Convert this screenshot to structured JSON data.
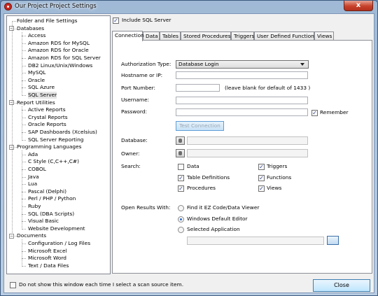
{
  "window": {
    "title": "Our Project Project Settings",
    "close_glyph": "x"
  },
  "tree": {
    "items": [
      {
        "label": "Folder and File Settings",
        "level": 0,
        "toggle": ""
      },
      {
        "label": "Databases",
        "level": 0,
        "toggle": "−"
      },
      {
        "label": "Access",
        "level": 1
      },
      {
        "label": "Amazon RDS for MySQL",
        "level": 1
      },
      {
        "label": "Amazon RDS for Oracle",
        "level": 1
      },
      {
        "label": "Amazon RDS for SQL Server",
        "level": 1
      },
      {
        "label": "DB2 Linux/Unix/Windows",
        "level": 1
      },
      {
        "label": "MySQL",
        "level": 1
      },
      {
        "label": "Oracle",
        "level": 1
      },
      {
        "label": "SQL Azure",
        "level": 1
      },
      {
        "label": "SQL Server",
        "level": 1,
        "selected": true
      },
      {
        "label": "Report Utilities",
        "level": 0,
        "toggle": "−"
      },
      {
        "label": "Active Reports",
        "level": 1
      },
      {
        "label": "Crystal Reports",
        "level": 1
      },
      {
        "label": "Oracle Reports",
        "level": 1
      },
      {
        "label": "SAP Dashboards (Xcelsius)",
        "level": 1
      },
      {
        "label": "SQL Server Reporting",
        "level": 1
      },
      {
        "label": "Programming Languages",
        "level": 0,
        "toggle": "−"
      },
      {
        "label": "Ada",
        "level": 1
      },
      {
        "label": "C Style (C,C++,C#)",
        "level": 1
      },
      {
        "label": "COBOL",
        "level": 1
      },
      {
        "label": "Java",
        "level": 1
      },
      {
        "label": "Lua",
        "level": 1
      },
      {
        "label": "Pascal (Delphi)",
        "level": 1
      },
      {
        "label": "Perl / PHP / Python",
        "level": 1
      },
      {
        "label": "Ruby",
        "level": 1
      },
      {
        "label": "SQL (DBA Scripts)",
        "level": 1
      },
      {
        "label": "Visual Basic",
        "level": 1
      },
      {
        "label": "Website Development",
        "level": 1
      },
      {
        "label": "Documents",
        "level": 0,
        "toggle": "−"
      },
      {
        "label": "Configuration / Log Files",
        "level": 1
      },
      {
        "label": "Microsoft Excel",
        "level": 1
      },
      {
        "label": "Microsoft Word",
        "level": 1
      },
      {
        "label": "Text / Data Files",
        "level": 1
      }
    ]
  },
  "include": {
    "label": "Include SQL Server",
    "checked": true
  },
  "tabs": [
    "Connection",
    "Data",
    "Tables",
    "Stored Procedures",
    "Triggers",
    "User Defined Functions",
    "Views"
  ],
  "active_tab": "Connection",
  "connection": {
    "auth_label": "Authorization Type:",
    "auth_value": "Database Login",
    "host_label": "Hostname or IP:",
    "host_value": "",
    "port_label": "Port Number:",
    "port_value": "",
    "port_hint": "(leave blank for default of 1433 )",
    "user_label": "Username:",
    "user_value": "",
    "pass_label": "Password:",
    "pass_value": "",
    "remember_label": "Remember",
    "remember_checked": true,
    "test_label": "Test Connection",
    "database_label": "Database:",
    "database_value": "",
    "owner_label": "Owner:",
    "owner_value": "",
    "search_label": "Search:",
    "search_options": {
      "data": {
        "label": "Data",
        "checked": false
      },
      "triggers": {
        "label": "Triggers",
        "checked": true
      },
      "table_defs": {
        "label": "Table Definitions",
        "checked": true
      },
      "functions": {
        "label": "Functions",
        "checked": true
      },
      "procedures": {
        "label": "Procedures",
        "checked": true
      },
      "views": {
        "label": "Views",
        "checked": true
      }
    },
    "open_label": "Open Results With:",
    "open_options": [
      {
        "label": "Find it EZ Code/Data Viewer",
        "selected": false
      },
      {
        "label": "Windows Default Editor",
        "selected": true
      },
      {
        "label": "Selected Application",
        "selected": false
      }
    ],
    "app_path": ""
  },
  "footer": {
    "dont_show_label": "Do not show this window each time I select a scan source item.",
    "dont_show_checked": false,
    "close_label": "Close"
  },
  "colors": {
    "accent": "#2b6cc8",
    "close_red": "#c7422b",
    "check_mark": "#2a3f8d"
  }
}
